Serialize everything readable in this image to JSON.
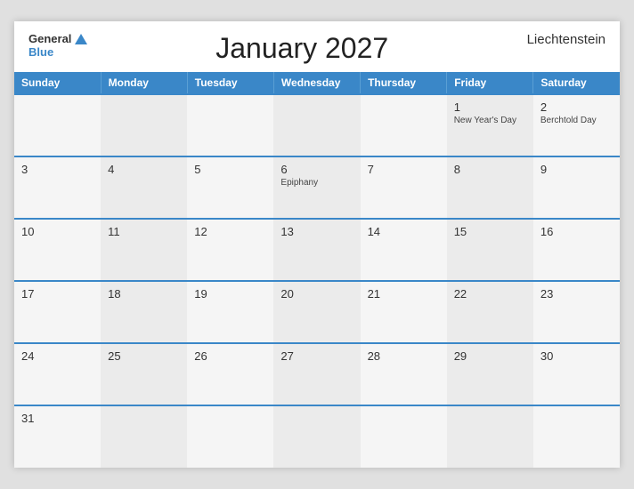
{
  "header": {
    "logo_general": "General",
    "logo_blue": "Blue",
    "title": "January 2027",
    "country": "Liechtenstein"
  },
  "weekdays": [
    "Sunday",
    "Monday",
    "Tuesday",
    "Wednesday",
    "Thursday",
    "Friday",
    "Saturday"
  ],
  "weeks": [
    [
      {
        "day": "",
        "event": ""
      },
      {
        "day": "",
        "event": ""
      },
      {
        "day": "",
        "event": ""
      },
      {
        "day": "",
        "event": ""
      },
      {
        "day": "",
        "event": ""
      },
      {
        "day": "1",
        "event": "New Year's Day"
      },
      {
        "day": "2",
        "event": "Berchtold Day"
      }
    ],
    [
      {
        "day": "3",
        "event": ""
      },
      {
        "day": "4",
        "event": ""
      },
      {
        "day": "5",
        "event": ""
      },
      {
        "day": "6",
        "event": "Epiphany"
      },
      {
        "day": "7",
        "event": ""
      },
      {
        "day": "8",
        "event": ""
      },
      {
        "day": "9",
        "event": ""
      }
    ],
    [
      {
        "day": "10",
        "event": ""
      },
      {
        "day": "11",
        "event": ""
      },
      {
        "day": "12",
        "event": ""
      },
      {
        "day": "13",
        "event": ""
      },
      {
        "day": "14",
        "event": ""
      },
      {
        "day": "15",
        "event": ""
      },
      {
        "day": "16",
        "event": ""
      }
    ],
    [
      {
        "day": "17",
        "event": ""
      },
      {
        "day": "18",
        "event": ""
      },
      {
        "day": "19",
        "event": ""
      },
      {
        "day": "20",
        "event": ""
      },
      {
        "day": "21",
        "event": ""
      },
      {
        "day": "22",
        "event": ""
      },
      {
        "day": "23",
        "event": ""
      }
    ],
    [
      {
        "day": "24",
        "event": ""
      },
      {
        "day": "25",
        "event": ""
      },
      {
        "day": "26",
        "event": ""
      },
      {
        "day": "27",
        "event": ""
      },
      {
        "day": "28",
        "event": ""
      },
      {
        "day": "29",
        "event": ""
      },
      {
        "day": "30",
        "event": ""
      }
    ],
    [
      {
        "day": "31",
        "event": ""
      },
      {
        "day": "",
        "event": ""
      },
      {
        "day": "",
        "event": ""
      },
      {
        "day": "",
        "event": ""
      },
      {
        "day": "",
        "event": ""
      },
      {
        "day": "",
        "event": ""
      },
      {
        "day": "",
        "event": ""
      }
    ]
  ],
  "colors": {
    "header_bg": "#3a87c8",
    "accent": "#3a87c8"
  }
}
